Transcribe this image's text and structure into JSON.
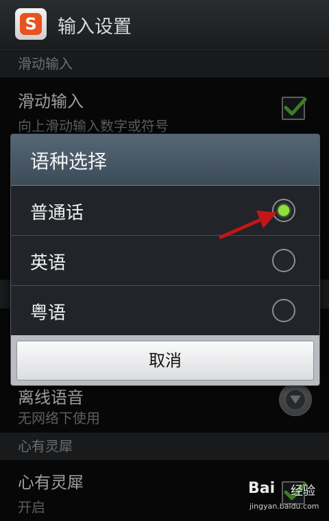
{
  "titlebar": {
    "title": "输入设置",
    "icon_letter": "S"
  },
  "sections": {
    "slide_header": "滑动输入",
    "heart_header": "心有灵犀"
  },
  "prefs": {
    "slide_title": "滑动输入",
    "slide_sub": "向上滑动输入数字或符号",
    "slide_checked": true,
    "offline_title": "离线语音",
    "offline_sub": "无网络下使用",
    "heart_title": "心有灵犀",
    "heart_sub": "开启",
    "heart_checked": true
  },
  "dialog": {
    "title": "语种选择",
    "options": [
      {
        "label": "普通话",
        "selected": true
      },
      {
        "label": "英语",
        "selected": false
      },
      {
        "label": "粤语",
        "selected": false
      }
    ],
    "cancel_label": "取消"
  },
  "watermark": {
    "brand": "Bai",
    "brand2": "经验",
    "url": "jingyan.baidu.com"
  },
  "colors": {
    "radio_selected": "#8fe03a",
    "checkmark": "#5fc23a",
    "arrow": "#c41616",
    "app_icon": "#e8531d"
  }
}
